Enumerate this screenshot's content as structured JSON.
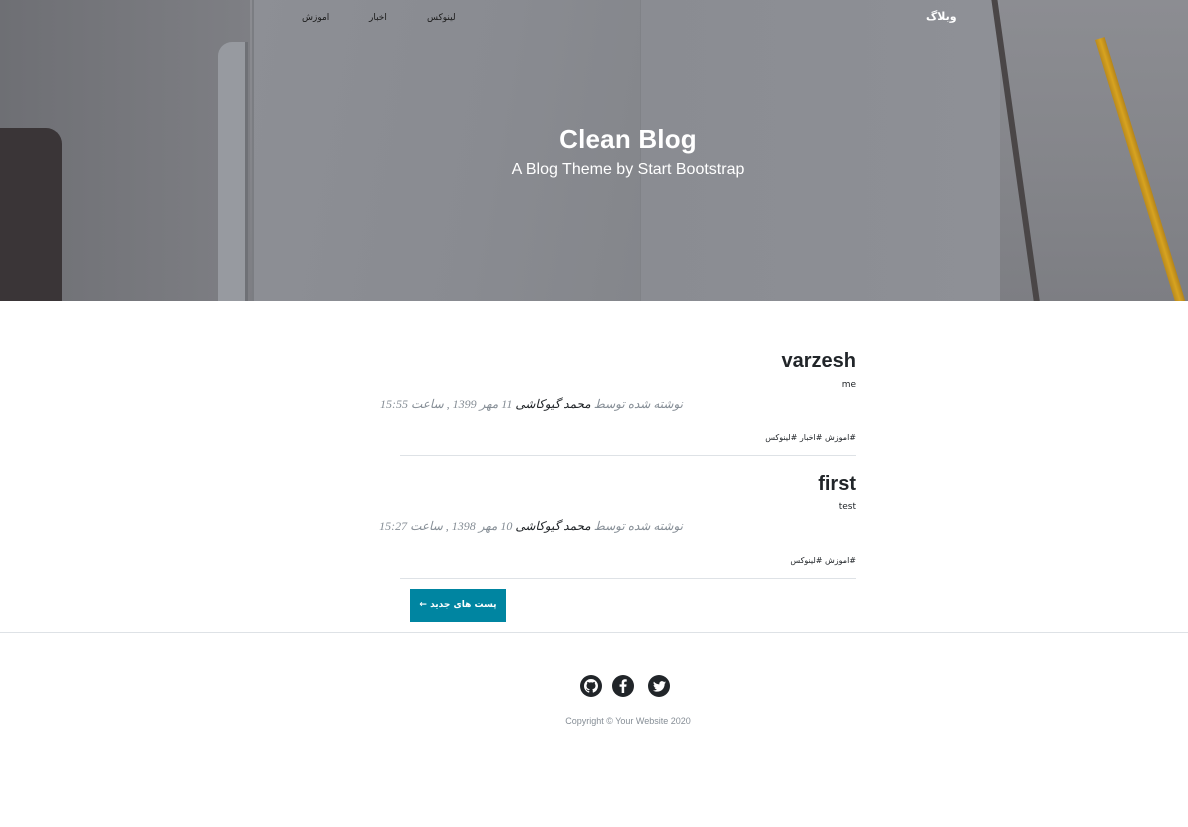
{
  "navbar": {
    "brand": "وبلاگ",
    "links": [
      "لینوکس",
      "اخبار",
      "اموزش"
    ]
  },
  "header": {
    "title": "Clean Blog",
    "subheading": "A Blog Theme by Start Bootstrap"
  },
  "posts": [
    {
      "title": "varzesh",
      "subtitle": "me",
      "meta_prefix": "نوشته شده توسط",
      "author": "محمد گیوکاشی",
      "meta_suffix": "11 مهر 1399 , ساعت 15:55",
      "tags": "#اموزش #اخبار #لینوکس"
    },
    {
      "title": "first",
      "subtitle": "test",
      "meta_prefix": "نوشته شده توسط",
      "author": "محمد گیوکاشی",
      "meta_suffix": "10 مهر 1398 , ساعت 15:27",
      "tags": "#اموزش #لینوکس"
    }
  ],
  "pager": {
    "older_label": "پست های جدید ←"
  },
  "footer": {
    "social": [
      "github-icon",
      "facebook-icon",
      "twitter-icon"
    ],
    "copyright": "Copyright © Your Website 2020"
  },
  "colors": {
    "accent": "#0085a1",
    "text": "#212529",
    "muted": "#868e96"
  }
}
